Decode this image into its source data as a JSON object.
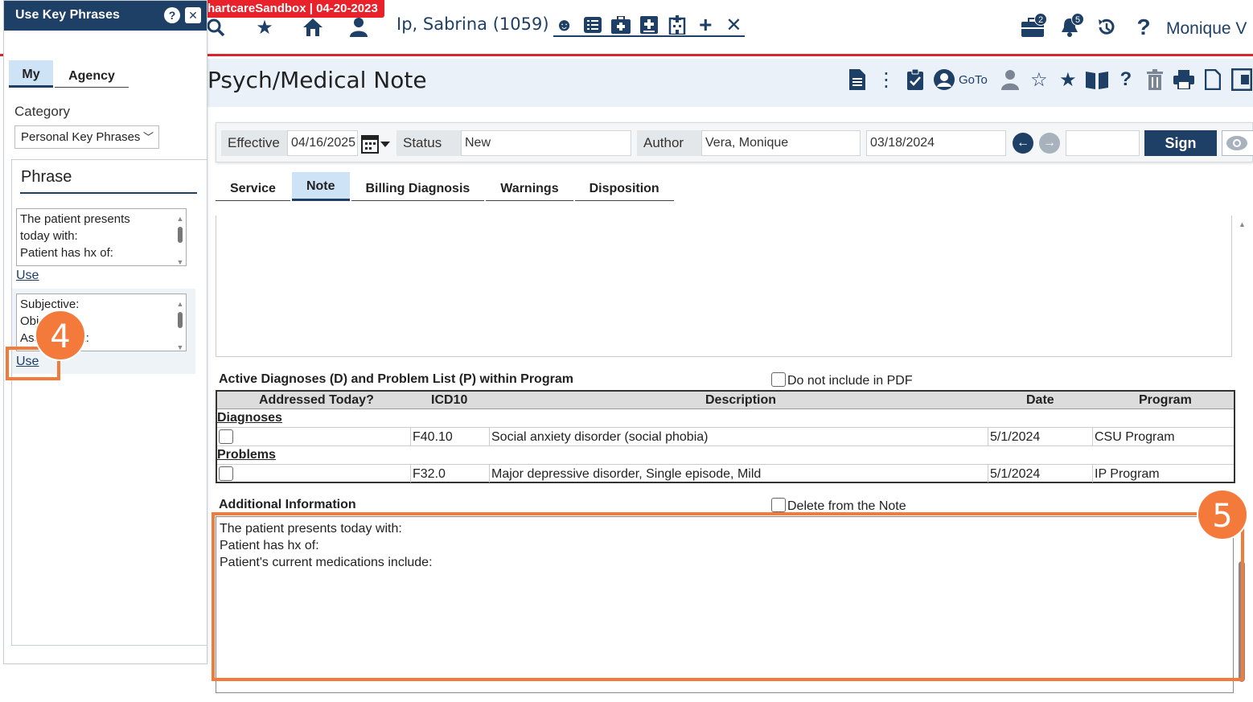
{
  "env_badge": "hartcareSandbox | 04-20-2023",
  "patient": {
    "name": "Ip, Sabrina (1059)"
  },
  "top_icons": [
    "search-icon",
    "star-icon",
    "home-icon",
    "person-icon"
  ],
  "patient_icons": [
    "smiley-icon",
    "list-icon",
    "medkit-icon",
    "med-plus-icon",
    "hospital-icon",
    "plus-icon",
    "close-icon"
  ],
  "right_icons": {
    "briefcase_badge": "2",
    "bell_badge": "5"
  },
  "user_name": "Monique V",
  "page_title": "Psych/Medical Note",
  "title_tools": {
    "goto_label": "GoTo"
  },
  "fields": {
    "effective_label": "Effective",
    "effective_value": "04/16/2025",
    "status_label": "Status",
    "status_value": "New",
    "author_label": "Author",
    "author_value": "Vera, Monique",
    "date_value": "03/18/2024",
    "sign_label": "Sign"
  },
  "tabs": [
    {
      "label": "Service"
    },
    {
      "label": "Note"
    },
    {
      "label": "Billing Diagnosis"
    },
    {
      "label": "Warnings"
    },
    {
      "label": "Disposition"
    }
  ],
  "diagnoses": {
    "title": "Active Diagnoses (D) and Problem List (P) within Program",
    "exclude_label": "Do not include in PDF",
    "columns": [
      "Addressed Today?",
      "ICD10",
      "Description",
      "Date",
      "Program"
    ],
    "group_diagnoses": "Diagnoses",
    "group_problems": "Problems",
    "rows": [
      {
        "icd10": "F40.10",
        "description": "Social anxiety disorder (social phobia)",
        "date": "5/1/2024",
        "program": "CSU Program"
      },
      {
        "icd10": "F32.0",
        "description": "Major depressive disorder, Single episode, Mild",
        "date": "5/1/2024",
        "program": "IP Program"
      }
    ]
  },
  "additional": {
    "title": "Additional Information",
    "delete_label": "Delete from the Note",
    "lines": [
      "The patient presents today with:",
      "Patient has hx of:",
      "Patient's current medications include:"
    ]
  },
  "key_phrases": {
    "title": "Use Key Phrases",
    "tab_my": "My",
    "tab_agency": "Agency",
    "category_label": "Category",
    "category_value": "Personal Key Phrases",
    "phrase_title": "Phrase",
    "phrases": [
      {
        "lines": [
          "The patient presents",
          "today with:",
          "Patient has hx of:"
        ],
        "use_label": "Use"
      },
      {
        "lines": [
          "Subjective:",
          "Objective:",
          "Assessment:"
        ],
        "use_label": "Use"
      }
    ]
  },
  "callouts": {
    "step4": "4",
    "step5": "5"
  },
  "colors": {
    "navy": "#1e3f66",
    "accent_red": "#d7262c",
    "callout_orange": "#f47a3c"
  }
}
